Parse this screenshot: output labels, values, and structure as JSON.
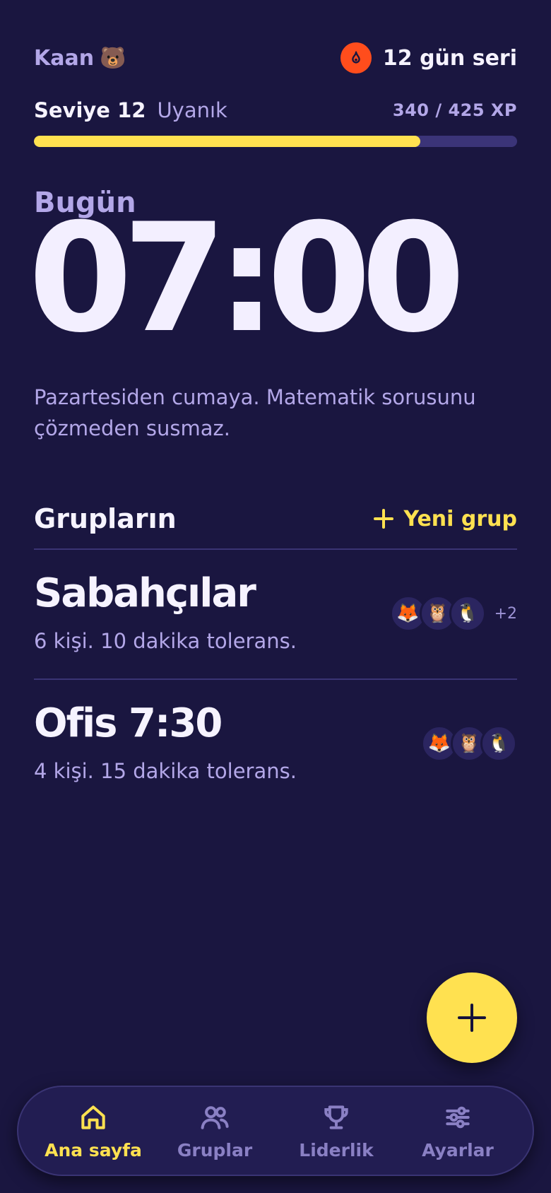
{
  "header": {
    "user_name": "Kaan",
    "user_emoji": "🐻",
    "streak_label": "12 gün seri",
    "streak_icon": "flame-icon"
  },
  "level": {
    "name": "Seviye 12",
    "title": "Uyanık",
    "xp_text": "340 / 425 XP",
    "progress_fraction": 0.8
  },
  "alarm": {
    "day_label": "Bugün",
    "time": "07:00",
    "description": "Pazartesiden cumaya. Matematik sorusunu çözmeden susmaz."
  },
  "groups_section": {
    "title": "Grupların",
    "new_group_label": "Yeni grup",
    "groups": [
      {
        "name": "Sabahçılar",
        "meta": "6 kişi. 10 dakika tolerans.",
        "avatars": [
          "🦊",
          "🦉",
          "🐧"
        ],
        "more": "+2"
      },
      {
        "name": "Ofis 7:30",
        "meta": "4 kişi. 15 dakika tolerans.",
        "avatars": [
          "🦊",
          "🦉",
          "🐧"
        ],
        "more": ""
      }
    ]
  },
  "nav": {
    "items": [
      {
        "label": "Ana sayfa",
        "icon": "home-icon",
        "active": true
      },
      {
        "label": "Gruplar",
        "icon": "users-icon",
        "active": false
      },
      {
        "label": "Liderlik",
        "icon": "trophy-icon",
        "active": false
      },
      {
        "label": "Ayarlar",
        "icon": "sliders-icon",
        "active": false
      }
    ]
  },
  "colors": {
    "background": "#1a1640",
    "accent": "#ffe150",
    "muted_text": "#b3a7e8",
    "streak": "#ff4d1c"
  }
}
